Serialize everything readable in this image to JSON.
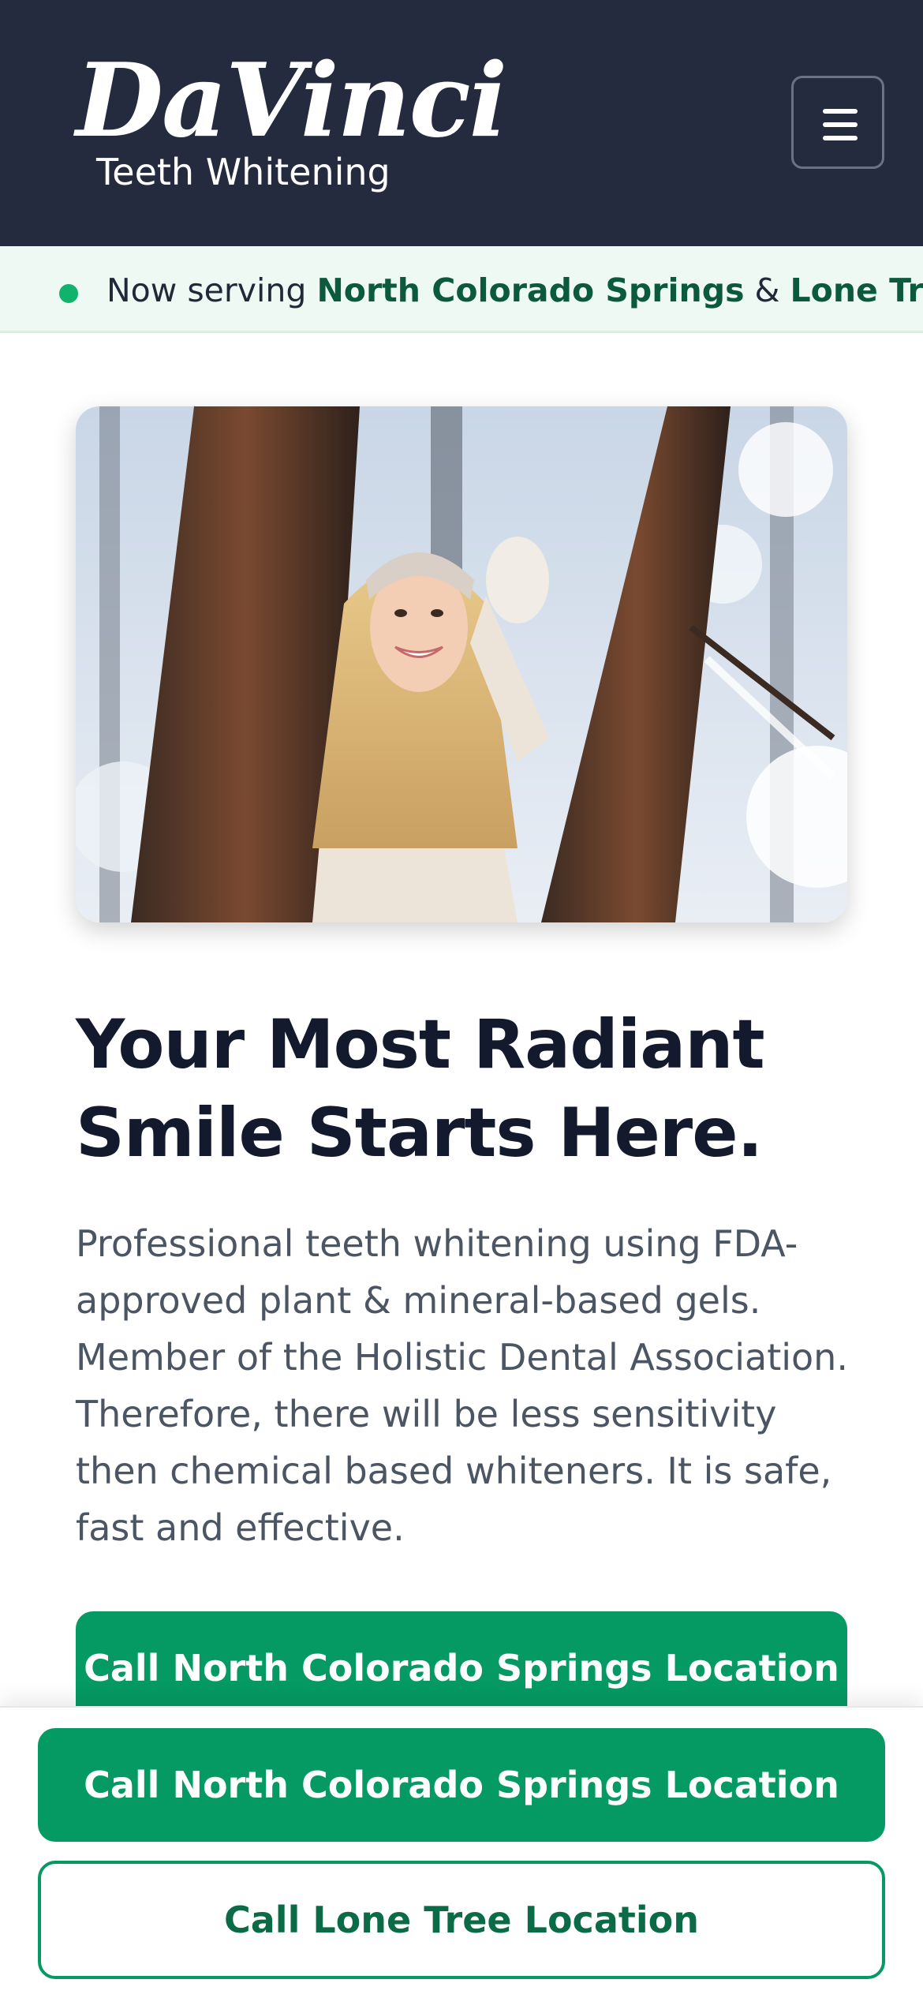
{
  "header": {
    "logo_script": "DaVinci",
    "logo_subtitle": "Teeth Whitening",
    "menu_icon": "hamburger-menu-icon"
  },
  "banner": {
    "prefix": "Now serving ",
    "location_1": "North Colorado Springs",
    "joiner": " & ",
    "location_2": "Lone Tree",
    "dot_color": "#10b26c"
  },
  "hero": {
    "image_subject": "smiling woman in snowy forest"
  },
  "main": {
    "headline": "Your Most Radiant Smile Starts Here.",
    "description": "Professional teeth whitening using FDA-approved plant & mineral-based gels. Member of the Holistic Dental Association. Therefore, there will be less sensitivity then chemical based whiteners. It is safe, fast and effective.",
    "cta_label": "Call North Colorado Springs Location"
  },
  "sticky_bar": {
    "primary_label": "Call North Colorado Springs Location",
    "secondary_label": "Call Lone Tree Location"
  },
  "colors": {
    "header_bg": "#242b3e",
    "accent": "#059a63",
    "banner_bg": "#edf9f2"
  }
}
